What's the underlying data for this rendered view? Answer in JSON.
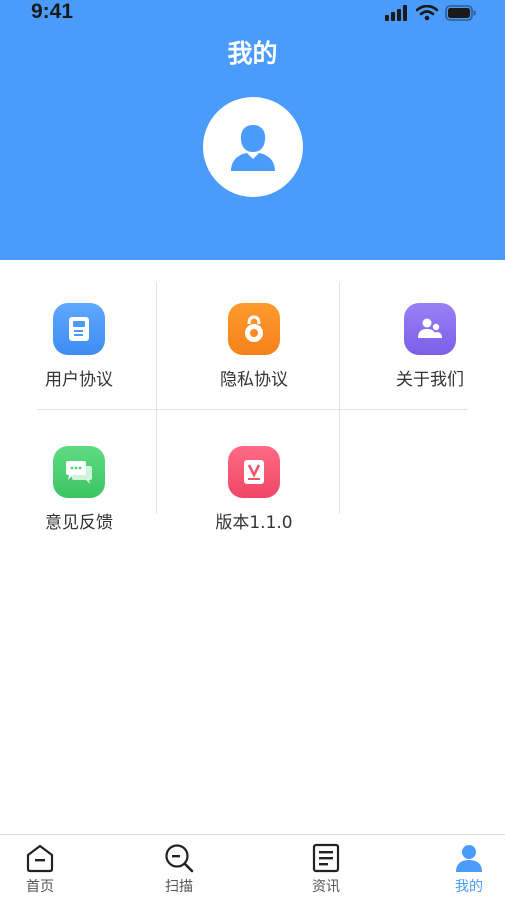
{
  "status_bar": {
    "time": "9:41"
  },
  "header": {
    "title": "我的"
  },
  "grid": [
    {
      "label": "用户协议",
      "icon": "document-icon",
      "color": "#4b9bfb"
    },
    {
      "label": "隐私协议",
      "icon": "privacy-lock-icon",
      "color": "#fb8c1e"
    },
    {
      "label": "关于我们",
      "icon": "people-icon",
      "color": "#8a6ff0"
    },
    {
      "label": "意见反馈",
      "icon": "chat-icon",
      "color": "#4cd171"
    },
    {
      "label": "版本1.1.0",
      "icon": "version-icon",
      "color": "#f4546f"
    }
  ],
  "tabbar": {
    "items": [
      {
        "label": "首页",
        "icon": "home-icon"
      },
      {
        "label": "扫描",
        "icon": "scan-icon"
      },
      {
        "label": "资讯",
        "icon": "news-icon"
      },
      {
        "label": "我的",
        "icon": "profile-icon",
        "active": true
      }
    ],
    "active_color": "#4b9bfb"
  }
}
